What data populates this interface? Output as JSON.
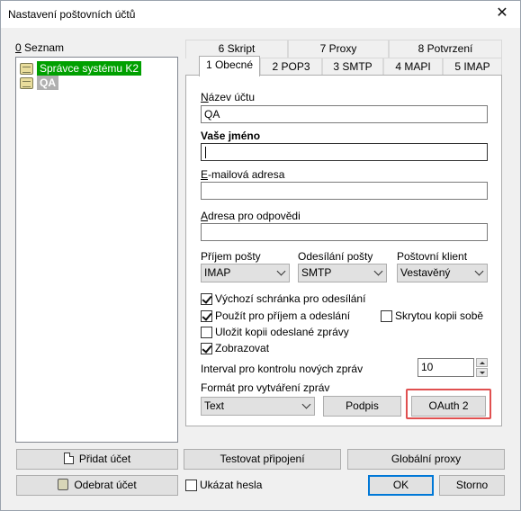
{
  "window": {
    "title": "Nastavení poštovních účtů",
    "close_glyph": "✕"
  },
  "list": {
    "label": "Seznam",
    "label_accel": "0",
    "items": [
      {
        "label": "Správce systému K2",
        "icon": "mailbox-icon"
      },
      {
        "label": "QA",
        "icon": "mailbox-icon"
      }
    ]
  },
  "tabs": {
    "row_back": [
      "6 Skript",
      "7 Proxy",
      "8 Potvrzení"
    ],
    "row_front": [
      "1 Obecné",
      "2 POP3",
      "3 SMTP",
      "4 MAPI",
      "5 IMAP"
    ]
  },
  "form": {
    "account_name_label": "Název účtu",
    "account_name_accel": "N",
    "account_name_value": "QA",
    "your_name_label": "Vaše jméno",
    "your_name_value": "",
    "email_label": "E-mailová adresa",
    "email_accel": "E",
    "email_value": "",
    "reply_label": "Adresa pro odpovědi",
    "reply_accel": "A",
    "reply_value": "",
    "incoming_label": "Příjem pošty",
    "incoming_value": "IMAP",
    "outgoing_label": "Odesílání pošty",
    "outgoing_value": "SMTP",
    "client_label": "Poštovní klient",
    "client_value": "Vestavěný",
    "checkboxes": {
      "default_box": {
        "label": "Výchozí schránka pro odesílání",
        "checked": true
      },
      "use_send_receive": {
        "label": "Použít pro příjem a odeslání",
        "checked": true
      },
      "hidden_copy": {
        "label": "Skrytou kopii sobě",
        "checked": false
      },
      "save_copy": {
        "label": "Uložit kopii odeslané zprávy",
        "checked": false
      },
      "show": {
        "label": "Zobrazovat",
        "checked": true
      }
    },
    "interval_label": "Interval pro kontrolu nových zpráv",
    "interval_value": "10",
    "format_label": "Formát pro vytváření zpráv",
    "format_value": "Text",
    "signature_button": "Podpis",
    "oauth_button": "OAuth 2"
  },
  "buttons": {
    "add_account": "Přidat účet",
    "remove_account": "Odebrat účet",
    "test_connection": "Testovat připojení",
    "global_proxy": "Globální proxy",
    "show_passwords": "Ukázat hesla",
    "ok": "OK",
    "cancel": "Storno"
  },
  "colors": {
    "selected_item": "#00a000",
    "highlight": "#e05050",
    "default_button": "#0078d7"
  }
}
